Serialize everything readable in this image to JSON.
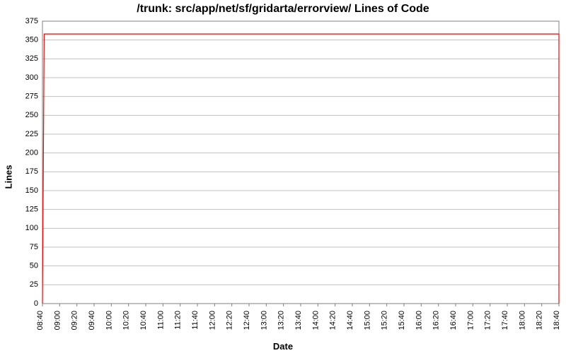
{
  "chart_data": {
    "type": "line",
    "title": "/trunk: src/app/net/sf/gridarta/errorview/ Lines of Code",
    "xlabel": "Date",
    "ylabel": "Lines",
    "ylim": [
      0,
      375
    ],
    "x_categories": [
      "08:40",
      "09:00",
      "09:20",
      "09:40",
      "10:00",
      "10:20",
      "10:40",
      "11:00",
      "11:20",
      "11:40",
      "12:00",
      "12:20",
      "12:40",
      "13:00",
      "13:20",
      "13:40",
      "14:00",
      "14:20",
      "14:40",
      "15:00",
      "15:20",
      "15:40",
      "16:00",
      "16:20",
      "16:40",
      "17:00",
      "17:20",
      "17:40",
      "18:00",
      "18:20",
      "18:40"
    ],
    "y_ticks": [
      0,
      25,
      50,
      75,
      100,
      125,
      150,
      175,
      200,
      225,
      250,
      275,
      300,
      325,
      350,
      375
    ],
    "series": [
      {
        "name": "Lines of Code",
        "color": "#ff0000",
        "x": [
          "08:40",
          "08:42",
          "18:40",
          "18:42"
        ],
        "y": [
          0,
          358,
          358,
          0
        ]
      }
    ]
  }
}
